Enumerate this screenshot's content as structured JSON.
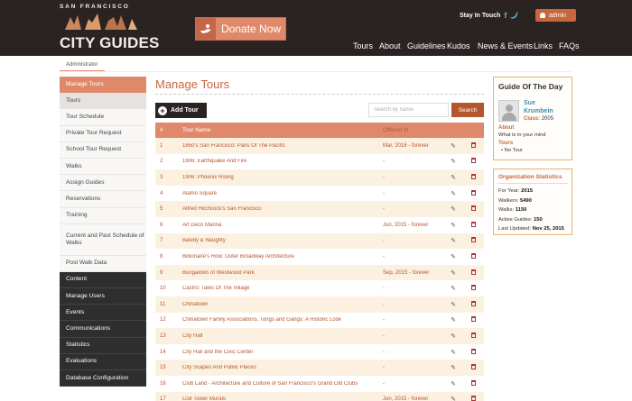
{
  "header": {
    "logo_top": "SAN FRANCISCO",
    "logo_bottom": "CITY GUIDES",
    "donate_label": "Donate Now",
    "stay_in_touch": "Stay In Touch",
    "admin_label": "admin",
    "nav": [
      "Tours",
      "About",
      "Guidelines",
      "Kudos",
      "News & Events",
      "Links",
      "FAQs"
    ]
  },
  "breadcrumb": "Administrator",
  "sidebar": {
    "heading": "Manage Tours",
    "items": [
      "Tours",
      "Tour Schedule",
      "Private Tour Request",
      "School Tour Request",
      "Walks",
      "Assign Guides",
      "Reservations",
      "Training",
      "Current and Past Schedule of Walks",
      "Post Walk Data"
    ],
    "sections": [
      "Content",
      "Manage Users",
      "Events",
      "Communications",
      "Statistics",
      "Evaluations",
      "Database Configuration"
    ]
  },
  "main": {
    "title": "Manage Tours",
    "add_button": "Add Tour",
    "search_placeholder": "Search by name",
    "search_button": "Search",
    "columns": [
      "#",
      "Tour Name",
      "Offered In"
    ],
    "rows": [
      {
        "num": "1",
        "name": "1850's San Francisco: Paris Of The Pacific",
        "offered": "Mar, 2016 - forever"
      },
      {
        "num": "2",
        "name": "1906: Earthquake And Fire",
        "offered": "-"
      },
      {
        "num": "3",
        "name": "1906: Phoenix Rising",
        "offered": "-"
      },
      {
        "num": "4",
        "name": "Alamo Square",
        "offered": "-"
      },
      {
        "num": "5",
        "name": "Alfred Hitchcock's San Francisco",
        "offered": "-"
      },
      {
        "num": "6",
        "name": "Art Deco Marina",
        "offered": "Jun, 2015 - forever"
      },
      {
        "num": "7",
        "name": "Bawdy & Naughty",
        "offered": "-"
      },
      {
        "num": "8",
        "name": "Billionaire's Row: Outer Broadway Architecture",
        "offered": "-"
      },
      {
        "num": "9",
        "name": "Bungalows of Westwood Park",
        "offered": "Sep, 2015 - forever"
      },
      {
        "num": "10",
        "name": "Castro: Tales Of The Village",
        "offered": "-"
      },
      {
        "num": "11",
        "name": "Chinatown",
        "offered": "-"
      },
      {
        "num": "12",
        "name": "Chinatown Family Associations, Tongs and Gangs: A Historic Look",
        "offered": "-"
      },
      {
        "num": "13",
        "name": "City Hall",
        "offered": "-"
      },
      {
        "num": "14",
        "name": "City Hall and the Civic Center",
        "offered": "-"
      },
      {
        "num": "15",
        "name": "City Scapes And Public Places",
        "offered": "-"
      },
      {
        "num": "16",
        "name": "Club Land - Architecture and Culture of San Francisco's Grand Old Clubs",
        "offered": "-"
      },
      {
        "num": "17",
        "name": "Coit Tower Murals",
        "offered": "Jun, 2015 - forever"
      }
    ]
  },
  "guide_of_day": {
    "title": "Guide Of The Day",
    "first_name": "Sue",
    "last_name": "Krumbein",
    "class_label": "Class:",
    "class_value": "2005",
    "about_label": "About",
    "about_text": "What is in your mind",
    "tours_label": "Tours",
    "tours_item": "No Tour"
  },
  "org_stats": {
    "title": "Organization Statistics",
    "lines": [
      {
        "label": "For Year:",
        "value": "2015"
      },
      {
        "label": "Walkers:",
        "value": "5490"
      },
      {
        "label": "Walks:",
        "value": "1150"
      },
      {
        "label": "Active Guides:",
        "value": "150"
      },
      {
        "label": "Last Updated:",
        "value": "Nov 25, 2015"
      }
    ]
  },
  "colors": {
    "header_bg": "#2a2322",
    "accent": "#e0896a",
    "accent_dark": "#b4562e",
    "row_alt": "#fcf1e0",
    "widget_border": "#e8b26a"
  }
}
